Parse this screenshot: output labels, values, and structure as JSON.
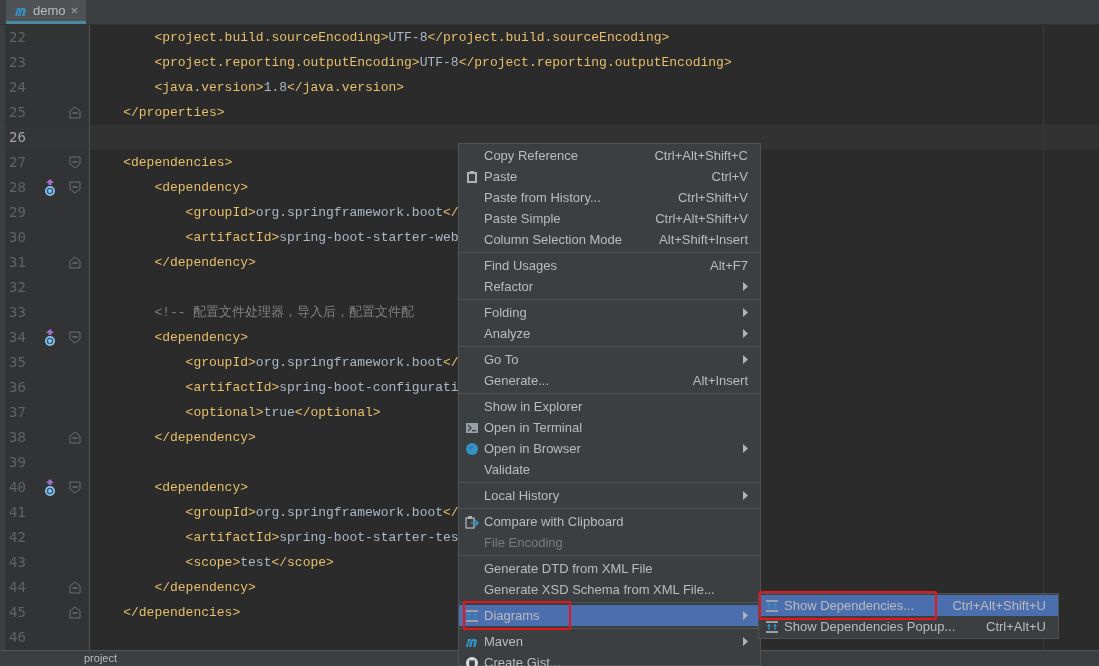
{
  "tabs": [
    {
      "label": "demo",
      "selected": true,
      "close": "×"
    }
  ],
  "editor": {
    "lines": [
      {
        "number": "22",
        "kind": "plain",
        "current": false,
        "segments": [
          {
            "kind": "tag",
            "text": "        <project.build.sourceEncoding>"
          },
          {
            "kind": "text",
            "text": "UTF-8"
          },
          {
            "kind": "tag",
            "text": "</project.build.sourceEncoding>"
          }
        ]
      },
      {
        "number": "23",
        "kind": "plain",
        "current": false,
        "segments": [
          {
            "kind": "tag",
            "text": "        <project.reporting.outputEncoding>"
          },
          {
            "kind": "text",
            "text": "UTF-8"
          },
          {
            "kind": "tag",
            "text": "</project.reporting.outputEncoding>"
          }
        ]
      },
      {
        "number": "24",
        "kind": "plain",
        "current": false,
        "segments": [
          {
            "kind": "tag",
            "text": "        <java.version>"
          },
          {
            "kind": "text",
            "text": "1.8"
          },
          {
            "kind": "tag",
            "text": "</java.version>"
          }
        ]
      },
      {
        "number": "25",
        "kind": "fold_end",
        "current": false,
        "segments": [
          {
            "kind": "tag",
            "text": "    </properties>"
          }
        ]
      },
      {
        "number": "26",
        "kind": "plain",
        "current": true
      },
      {
        "number": "27",
        "kind": "fold_start",
        "current": false,
        "segments": [
          {
            "kind": "tag",
            "text": "    <dependencies>"
          }
        ]
      },
      {
        "number": "28",
        "kind": "fold_start",
        "current": false,
        "marker": true,
        "segments": [
          {
            "kind": "tag",
            "text": "        <dependency>"
          }
        ]
      },
      {
        "number": "29",
        "kind": "plain",
        "current": false,
        "segments": [
          {
            "kind": "tag",
            "text": "            <groupId>"
          },
          {
            "kind": "text",
            "text": "org.springframework.boot"
          },
          {
            "kind": "tag",
            "text": "</"
          }
        ]
      },
      {
        "number": "30",
        "kind": "plain",
        "current": false,
        "segments": [
          {
            "kind": "tag",
            "text": "            <artifactId>"
          },
          {
            "kind": "text",
            "text": "spring-boot-starter-web"
          }
        ]
      },
      {
        "number": "31",
        "kind": "fold_end",
        "current": false,
        "segments": [
          {
            "kind": "tag",
            "text": "        </dependency>"
          }
        ]
      },
      {
        "number": "32",
        "kind": "plain",
        "current": false
      },
      {
        "number": "33",
        "kind": "plain",
        "current": false,
        "segments": [
          {
            "kind": "comment",
            "text": "        <!-- 配置文件处理器，导入后，配置文件配"
          }
        ]
      },
      {
        "number": "34",
        "kind": "fold_start",
        "current": false,
        "marker": true,
        "segments": [
          {
            "kind": "tag",
            "text": "        <dependency>"
          }
        ]
      },
      {
        "number": "35",
        "kind": "plain",
        "current": false,
        "segments": [
          {
            "kind": "tag",
            "text": "            <groupId>"
          },
          {
            "kind": "text",
            "text": "org.springframework.boot"
          },
          {
            "kind": "tag",
            "text": "</"
          }
        ]
      },
      {
        "number": "36",
        "kind": "plain",
        "current": false,
        "segments": [
          {
            "kind": "tag",
            "text": "            <artifactId>"
          },
          {
            "kind": "text",
            "text": "spring-boot-configurati"
          }
        ]
      },
      {
        "number": "37",
        "kind": "plain",
        "current": false,
        "segments": [
          {
            "kind": "tag",
            "text": "            <optional>"
          },
          {
            "kind": "text",
            "text": "true"
          },
          {
            "kind": "tag",
            "text": "</optional>"
          }
        ]
      },
      {
        "number": "38",
        "kind": "fold_end",
        "current": false,
        "segments": [
          {
            "kind": "tag",
            "text": "        </dependency>"
          }
        ]
      },
      {
        "number": "39",
        "kind": "plain",
        "current": false
      },
      {
        "number": "40",
        "kind": "fold_start",
        "current": false,
        "marker": true,
        "segments": [
          {
            "kind": "tag",
            "text": "        <dependency>"
          }
        ]
      },
      {
        "number": "41",
        "kind": "plain",
        "current": false,
        "segments": [
          {
            "kind": "tag",
            "text": "            <groupId>"
          },
          {
            "kind": "text",
            "text": "org.springframework.boot"
          },
          {
            "kind": "tag",
            "text": "</"
          }
        ]
      },
      {
        "number": "42",
        "kind": "plain",
        "current": false,
        "segments": [
          {
            "kind": "tag",
            "text": "            <artifactId>"
          },
          {
            "kind": "text",
            "text": "spring-boot-starter-tes"
          }
        ]
      },
      {
        "number": "43",
        "kind": "plain",
        "current": false,
        "segments": [
          {
            "kind": "tag",
            "text": "            <scope>"
          },
          {
            "kind": "text",
            "text": "test"
          },
          {
            "kind": "tag",
            "text": "</scope>"
          }
        ]
      },
      {
        "number": "44",
        "kind": "fold_end",
        "current": false,
        "segments": [
          {
            "kind": "tag",
            "text": "        </dependency>"
          }
        ]
      },
      {
        "number": "45",
        "kind": "fold_end",
        "current": false,
        "segments": [
          {
            "kind": "tag",
            "text": "    </dependencies>"
          }
        ]
      },
      {
        "number": "46",
        "kind": "plain",
        "current": false
      }
    ]
  },
  "breadcrumb": "project",
  "context_menu": {
    "items": [
      {
        "kind": "plain",
        "label": "Copy Reference",
        "shortcut": "Ctrl+Alt+Shift+C",
        "selected": false,
        "disabled": false
      },
      {
        "kind": "clipboard",
        "label": "Paste",
        "shortcut": "Ctrl+V",
        "selected": false,
        "disabled": false
      },
      {
        "kind": "plain",
        "label": "Paste from History...",
        "shortcut": "Ctrl+Shift+V",
        "selected": false,
        "disabled": false
      },
      {
        "kind": "plain",
        "label": "Paste Simple",
        "shortcut": "Ctrl+Alt+Shift+V",
        "selected": false,
        "disabled": false
      },
      {
        "kind": "plain",
        "label": "Column Selection Mode",
        "shortcut": "Alt+Shift+Insert",
        "selected": false,
        "disabled": false
      },
      {
        "kind": "separator"
      },
      {
        "kind": "plain",
        "label": "Find Usages",
        "shortcut": "Alt+F7",
        "selected": false,
        "disabled": false
      },
      {
        "kind": "plain",
        "label": "Refactor",
        "submenu": true,
        "selected": false,
        "disabled": false
      },
      {
        "kind": "separator"
      },
      {
        "kind": "plain",
        "label": "Folding",
        "submenu": true,
        "selected": false,
        "disabled": false
      },
      {
        "kind": "plain",
        "label": "Analyze",
        "submenu": true,
        "selected": false,
        "disabled": false
      },
      {
        "kind": "separator"
      },
      {
        "kind": "plain",
        "label": "Go To",
        "submenu": true,
        "selected": false,
        "disabled": false
      },
      {
        "kind": "plain",
        "label": "Generate...",
        "shortcut": "Alt+Insert",
        "selected": false,
        "disabled": false
      },
      {
        "kind": "separator"
      },
      {
        "kind": "plain",
        "label": "Show in Explorer",
        "selected": false,
        "disabled": false
      },
      {
        "kind": "terminal",
        "label": "Open in Terminal",
        "selected": false,
        "disabled": false
      },
      {
        "kind": "globe",
        "label": "Open in Browser",
        "submenu": true,
        "selected": false,
        "disabled": false
      },
      {
        "kind": "plain",
        "label": "Validate",
        "selected": false,
        "disabled": false
      },
      {
        "kind": "separator"
      },
      {
        "kind": "plain",
        "label": "Local History",
        "submenu": true,
        "selected": false,
        "disabled": false
      },
      {
        "kind": "separator"
      },
      {
        "kind": "compare",
        "label": "Compare with Clipboard",
        "selected": false,
        "disabled": false
      },
      {
        "kind": "plain",
        "label": "File Encoding",
        "selected": false,
        "disabled": true
      },
      {
        "kind": "separator"
      },
      {
        "kind": "plain",
        "label": "Generate DTD from XML File",
        "selected": false,
        "disabled": false
      },
      {
        "kind": "plain",
        "label": "Generate XSD Schema from XML File...",
        "selected": false,
        "disabled": false
      },
      {
        "kind": "separator"
      },
      {
        "kind": "diagram",
        "label": "Diagrams",
        "submenu": true,
        "selected": true,
        "disabled": false,
        "annotated": true
      },
      {
        "kind": "separator"
      },
      {
        "kind": "maven",
        "label": "Maven",
        "submenu": true,
        "selected": false,
        "disabled": false
      },
      {
        "kind": "github",
        "label": "Create Gist...",
        "selected": false,
        "disabled": false
      }
    ]
  },
  "submenu": {
    "items": [
      {
        "kind": "diagram",
        "label": "Show Dependencies...",
        "shortcut": "Ctrl+Alt+Shift+U",
        "selected": true,
        "disabled": false,
        "annotated": true
      },
      {
        "kind": "diagram",
        "label": "Show Dependencies Popup...",
        "shortcut": "Ctrl+Alt+U",
        "selected": false,
        "disabled": false,
        "annotated": false
      }
    ]
  }
}
